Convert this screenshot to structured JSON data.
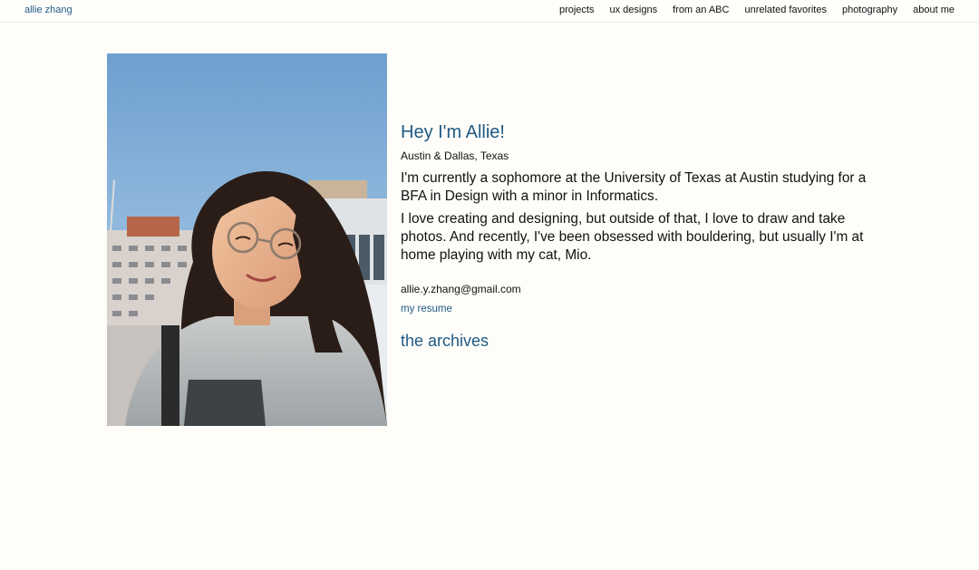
{
  "brand": {
    "name": "allie zhang"
  },
  "nav": {
    "items": [
      {
        "label": "projects"
      },
      {
        "label": "ux designs"
      },
      {
        "label": "from an ABC"
      },
      {
        "label": "unrelated favorites"
      },
      {
        "label": "photography"
      },
      {
        "label": "about me"
      }
    ]
  },
  "intro": {
    "greeting": "Hey I'm Allie!",
    "location": "Austin & Dallas, Texas",
    "bio": [
      "I'm currently a sophomore at the University of Texas at Austin studying for a BFA in Design with a minor in Informatics.",
      "I love creating and designing, but outside of that, I love to draw and take photos. And recently, I've been obsessed with bouldering, but usually I'm at home playing with my cat, Mio."
    ],
    "email": "allie.y.zhang@gmail.com",
    "resume_label": "my resume",
    "archives_label": "the archives"
  },
  "colors": {
    "accent": "#1f5a85",
    "background": "#fffdf9",
    "text": "#111111"
  }
}
